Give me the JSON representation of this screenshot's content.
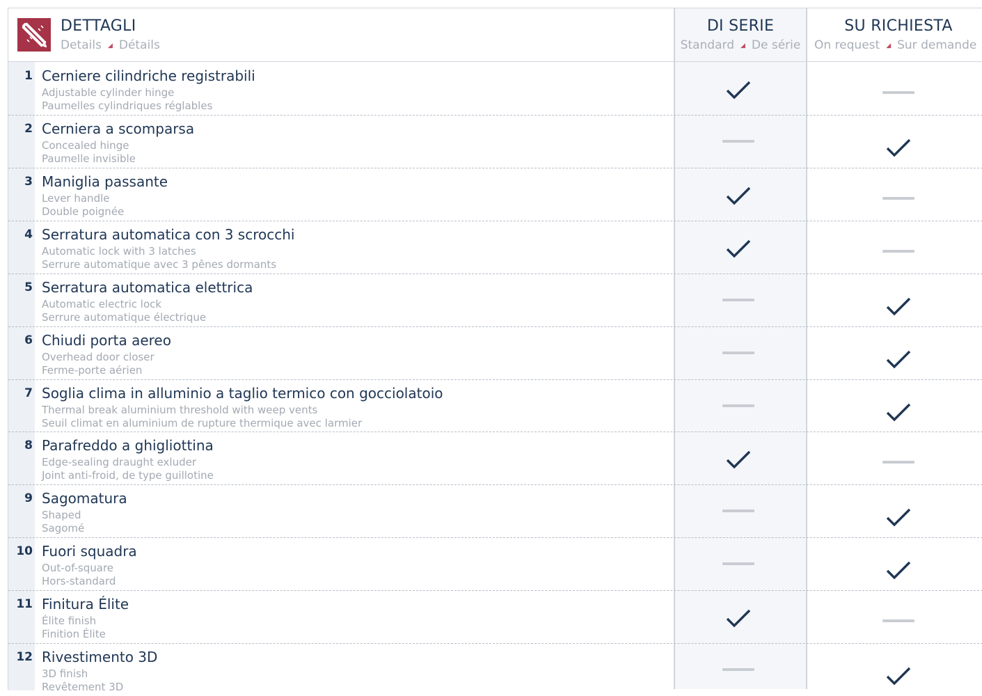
{
  "header": {
    "title": "DETTAGLI",
    "sub_en": "Details",
    "sub_fr": "Détails",
    "col_std_title": "DI SERIE",
    "col_std_en": "Standard",
    "col_std_fr": "De série",
    "col_req_title": "SU RICHIESTA",
    "col_req_en": "On request",
    "col_req_fr": "Sur demande",
    "logo_icon": "pencil-ruler-icon",
    "accent_color": "#a63347",
    "text_color": "#1f3654"
  },
  "rows": [
    {
      "num": "1",
      "it": "Cerniere cilindriche registrabili",
      "en": "Adjustable cylinder hinge",
      "fr": "Paumelles cylindriques réglables",
      "standard": true
    },
    {
      "num": "2",
      "it": "Cerniera a scomparsa",
      "en": "Concealed hinge",
      "fr": "Paumelle invisible",
      "standard": false
    },
    {
      "num": "3",
      "it": "Maniglia passante",
      "en": "Lever handle",
      "fr": "Double poignée",
      "standard": true
    },
    {
      "num": "4",
      "it": "Serratura automatica con 3 scrocchi",
      "en": "Automatic lock with 3 latches",
      "fr": "Serrure automatique avec 3 pênes dormants",
      "standard": true
    },
    {
      "num": "5",
      "it": "Serratura automatica elettrica",
      "en": "Automatic electric lock",
      "fr": "Serrure automatique électrique",
      "standard": false
    },
    {
      "num": "6",
      "it": "Chiudi porta aereo",
      "en": "Overhead door closer",
      "fr": "Ferme-porte aérien",
      "standard": false
    },
    {
      "num": "7",
      "it": "Soglia clima in alluminio a taglio termico con gocciolatoio",
      "en": "Thermal break aluminium threshold with weep vents",
      "fr": "Seuil climat en aluminium de rupture thermique avec larmier",
      "standard": false
    },
    {
      "num": "8",
      "it": "Parafreddo a ghigliottina",
      "en": "Edge-sealing draught exluder",
      "fr": "Joint anti-froid, de type guillotine",
      "standard": true
    },
    {
      "num": "9",
      "it": "Sagomatura",
      "en": "Shaped",
      "fr": "Sagomé",
      "standard": false
    },
    {
      "num": "10",
      "it": "Fuori squadra",
      "en": "Out-of-square",
      "fr": "Hors-standard",
      "standard": false
    },
    {
      "num": "11",
      "it": "Finitura Élite",
      "en": "Élite finish",
      "fr": "Finition Élite",
      "standard": true
    },
    {
      "num": "12",
      "it": "Rivestimento 3D",
      "en": "3D finish",
      "fr": "Revêtement 3D",
      "standard": false
    }
  ]
}
